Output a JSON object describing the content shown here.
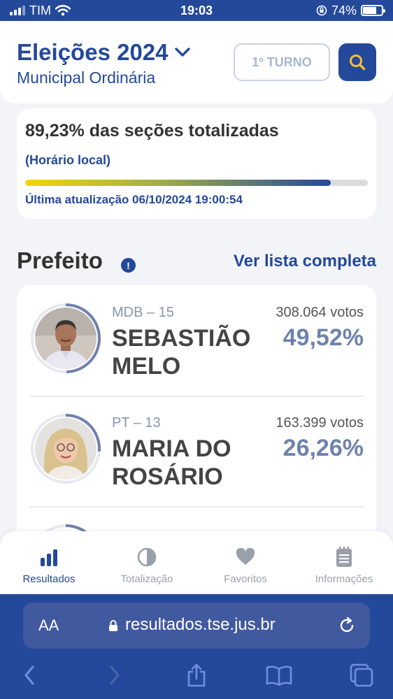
{
  "status_bar": {
    "carrier": "TIM",
    "time": "19:03",
    "battery": "74%",
    "battery_level": 0.74
  },
  "header": {
    "title": "Eleições 2024",
    "subtitle": "Municipal Ordinária",
    "turno_label": "1º TURNO"
  },
  "progress": {
    "title": "89,23% das seções totalizadas",
    "note": "(Horário local)",
    "fraction": 0.8923,
    "updated": "Última atualização 06/10/2024 19:00:54"
  },
  "section": {
    "title": "Prefeito",
    "see_all": "Ver lista completa"
  },
  "candidates": [
    {
      "party": "MDB – 15",
      "name_line1": "SEBASTIÃO",
      "name_line2": "MELO",
      "votes": "308.064 votos",
      "percent": "49,52%",
      "share": 0.4952
    },
    {
      "party": "PT – 13",
      "name_line1": "MARIA DO",
      "name_line2": "ROSÁRIO",
      "votes": "163.399 votos",
      "percent": "26,26%",
      "share": 0.2626
    }
  ],
  "tabs": [
    {
      "label": "Resultados",
      "icon": "bar-chart-icon"
    },
    {
      "label": "Totalização",
      "icon": "pie-chart-icon"
    },
    {
      "label": "Favoritos",
      "icon": "heart-icon"
    },
    {
      "label": "Informações",
      "icon": "notepad-icon"
    }
  ],
  "browser": {
    "text_size_label": "AA",
    "url": "resultados.tse.jus.br"
  },
  "colors": {
    "brand": "#24499a",
    "accent": "#f2d60e"
  }
}
